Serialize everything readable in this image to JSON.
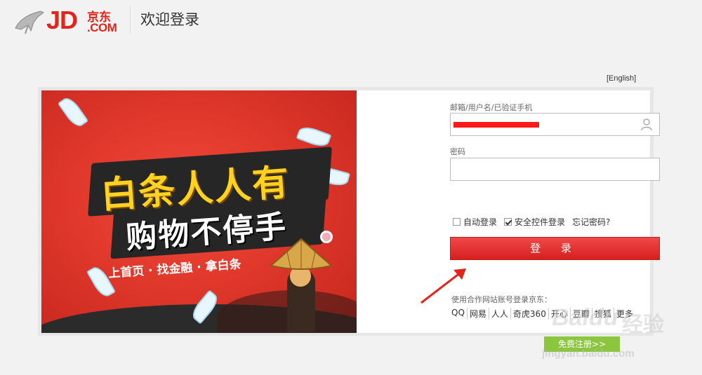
{
  "header": {
    "logo_text": "JD",
    "logo_cn": "京东",
    "logo_com": ".COM",
    "title": "欢迎登录"
  },
  "lang_link": "[English]",
  "banner": {
    "line1": "白条人人有",
    "line2": "购物不停手",
    "line3": "上首页 · 找金融 · 拿白条"
  },
  "form": {
    "user_label": "邮箱/用户名/已验证手机",
    "user_value": "",
    "password_label": "密码",
    "password_value": "",
    "auto_login_label": "自动登录",
    "auto_login_checked": false,
    "security_label": "安全控件登录",
    "security_checked": true,
    "forgot_label": "忘记密码?",
    "login_button": "登 录"
  },
  "partners": {
    "label": "使用合作网站账号登录京东：",
    "items": [
      "QQ",
      "网易",
      "人人",
      "奇虎360",
      "开心",
      "豆瓣",
      "搜狐",
      "更多"
    ]
  },
  "register_button": "免费注册>>",
  "watermark": {
    "brand": "Baidu",
    "cn": "经验",
    "url": "jingyan.baidu.com"
  },
  "colors": {
    "brand_red": "#e1251b",
    "register_green": "#8cc63f"
  }
}
